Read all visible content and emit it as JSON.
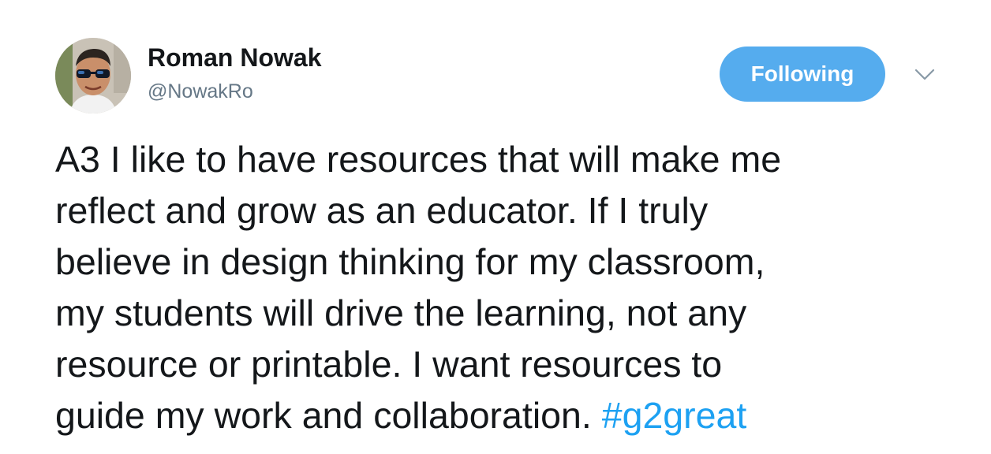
{
  "author": {
    "name": "Roman Nowak",
    "handle": "@NowakRo"
  },
  "follow_button": {
    "label": "Following",
    "color": "#55acee"
  },
  "menu": {
    "icon": "chevron-down-icon"
  },
  "tweet": {
    "lines": [
      "A3 I like to have resources that will make me",
      "reflect and grow as an educator. If I truly",
      "believe in design thinking for my classroom,",
      "my students will drive the learning, not any",
      "resource or printable. I want resources to",
      "guide my work and collaboration. "
    ],
    "hashtag": "#g2great",
    "hashtag_color": "#1da1f2"
  }
}
